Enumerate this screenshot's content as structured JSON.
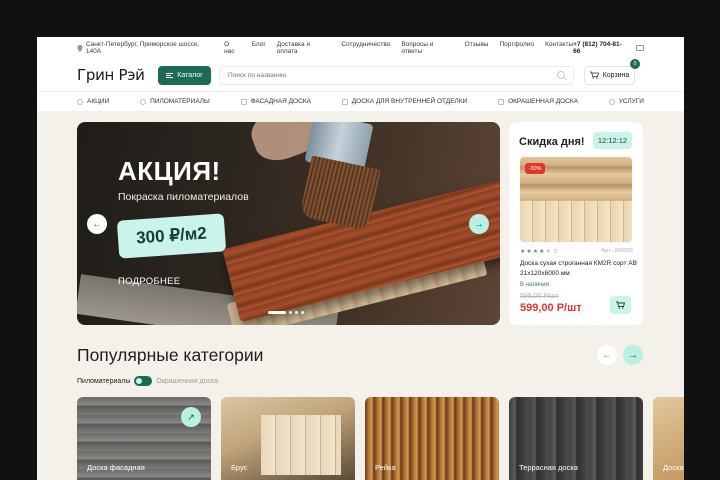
{
  "topbar": {
    "address": "Санкт-Петербург, Приморское шоссе, 140А",
    "links": [
      "О нас",
      "Блог",
      "Доставка и оплата",
      "Сотрудничество",
      "Вопросы и ответы",
      "Отзывы",
      "Портфолио",
      "Контакты"
    ],
    "phone": "+7 (812) 704-81-66"
  },
  "header": {
    "logo": "Грин Рэй",
    "catalog_label": "Каталог",
    "search_placeholder": "Поиск по названию",
    "cart_label": "Корзина",
    "cart_count": "0"
  },
  "nav": {
    "items": [
      "АКЦИИ",
      "ПИЛОМАТЕРИАЛЫ",
      "ФАСАДНАЯ ДОСКА",
      "ДОСКА ДЛЯ ВНУТРЕННЕЙ ОТДЕЛКИ",
      "ОКРАШЕННАЯ ДОСКА",
      "УСЛУГИ"
    ]
  },
  "banner": {
    "title": "АКЦИЯ!",
    "subtitle": "Покраска пиломатериалов",
    "price": "300 ₽/м2",
    "more": "ПОДРОБНЕЕ",
    "slide_count": 4,
    "active_slide": 1
  },
  "deal": {
    "title": "Скидка дня!",
    "timer": "12:12:12",
    "discount": "-30%",
    "rating": 4,
    "rating_count": "5",
    "article": "Арт.: 999555",
    "name": "Доска сухая строганная КМ2R сорт АВ 21х120х6000 мм",
    "stock": "В наличии",
    "old_price": "599,00 Р/шт",
    "new_price": "599,00 Р/шт"
  },
  "popular": {
    "title": "Популярные категории",
    "toggle_on": "Пиломатериалы",
    "toggle_off": "Окрашенная доска",
    "categories": [
      "Доска фасадная",
      "Брус",
      "Рейка",
      "Террасная доска",
      "Доска"
    ]
  },
  "colors": {
    "brand_green": "#1c6b55",
    "mint": "#c8f4ea",
    "sale_red": "#e0362b",
    "page_bg": "#f4f0ea"
  }
}
